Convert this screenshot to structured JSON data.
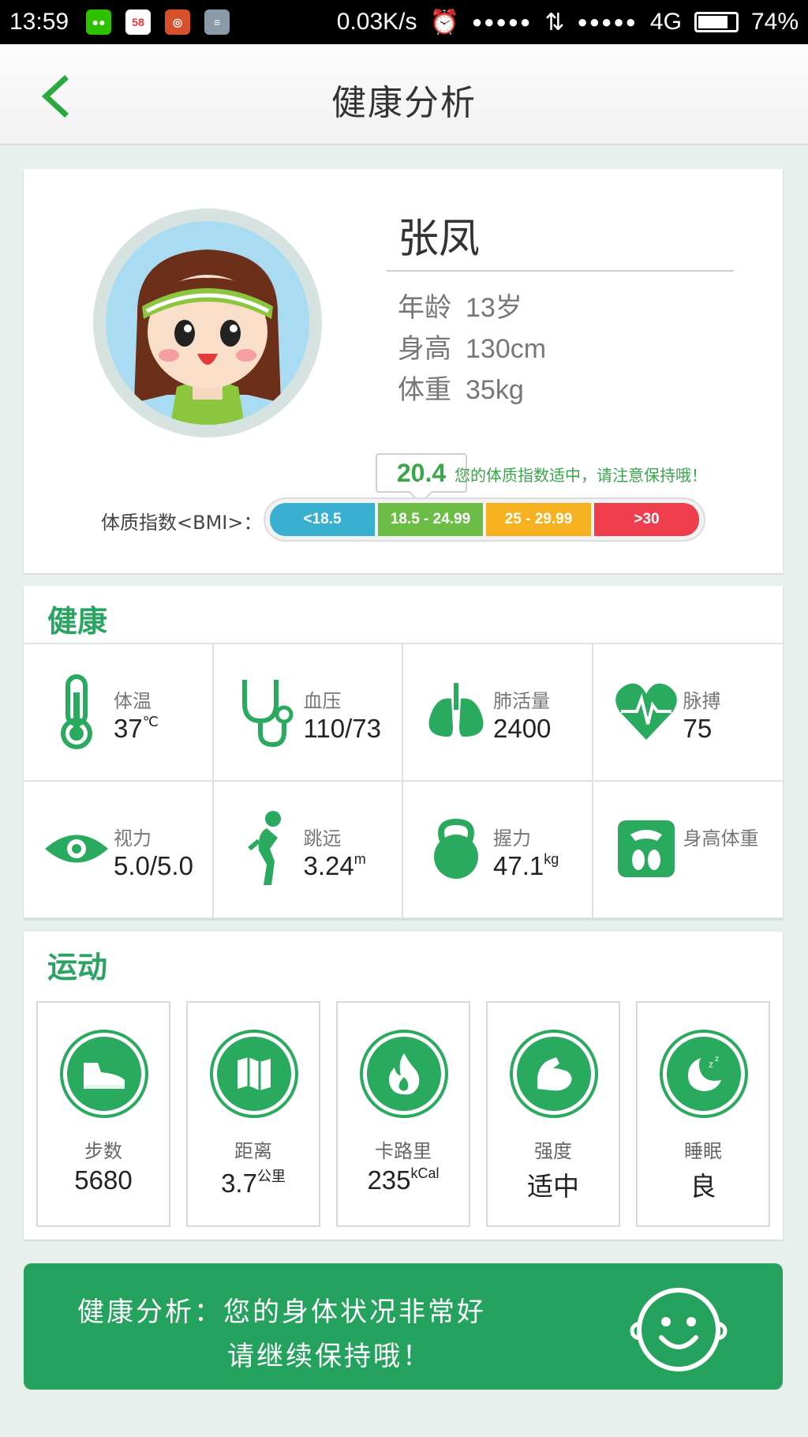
{
  "status_bar": {
    "time": "13:59",
    "network_speed": "0.03K/s",
    "signal_dots_1": "●●●●●",
    "signal_dots_2": "●●●●●",
    "network_type": "4G",
    "battery": "74%",
    "app_58": "58"
  },
  "header": {
    "title": "健康分析"
  },
  "profile": {
    "name": "张凤",
    "age_label": "年龄",
    "age_value": "13岁",
    "height_label": "身高",
    "height_value": "130cm",
    "weight_label": "体重",
    "weight_value": "35kg",
    "bmi_value": "20.4",
    "bmi_message": "您的体质指数适中，请注意保持哦！",
    "bmi_label": "体质指数<BMI>：",
    "bmi_ranges": [
      {
        "label": "<18.5",
        "color": "#3ab0d0"
      },
      {
        "label": "18.5 - 24.99",
        "color": "#6cbd45"
      },
      {
        "label": "25 - 29.99",
        "color": "#f5b120"
      },
      {
        "label": ">30",
        "color": "#ee3e4d"
      }
    ]
  },
  "health": {
    "title": "健康",
    "items": [
      {
        "icon": "thermometer-icon",
        "label": "体温",
        "value": "37",
        "unit": "℃"
      },
      {
        "icon": "stethoscope-icon",
        "label": "血压",
        "value": "110/73",
        "unit": ""
      },
      {
        "icon": "lungs-icon",
        "label": "肺活量",
        "value": "2400",
        "unit": ""
      },
      {
        "icon": "heart-pulse-icon",
        "label": "脉搏",
        "value": "75",
        "unit": ""
      },
      {
        "icon": "eye-icon",
        "label": "视力",
        "value": "5.0/5.0",
        "unit": ""
      },
      {
        "icon": "long-jump-icon",
        "label": "跳远",
        "value": "3.24",
        "unit": "m"
      },
      {
        "icon": "kettlebell-icon",
        "label": "握力",
        "value": "47.1",
        "unit": "kg"
      },
      {
        "icon": "scale-icon",
        "label": "身高体重",
        "value": "",
        "unit": ""
      }
    ]
  },
  "sport": {
    "title": "运动",
    "items": [
      {
        "icon": "shoe-icon",
        "label": "步数",
        "value": "5680",
        "unit": ""
      },
      {
        "icon": "map-icon",
        "label": "距离",
        "value": "3.7",
        "unit": "公里"
      },
      {
        "icon": "flame-icon",
        "label": "卡路里",
        "value": "235",
        "unit": "kCal"
      },
      {
        "icon": "muscle-icon",
        "label": "强度",
        "value": "适中",
        "unit": ""
      },
      {
        "icon": "moon-sleep-icon",
        "label": "睡眠",
        "value": "良",
        "unit": ""
      }
    ]
  },
  "analysis": {
    "line1": "健康分析：您的身体状况非常好",
    "line2": "请继续保持哦！"
  },
  "colors": {
    "brand_green": "#25a25e",
    "accent_green": "#2aaa5e",
    "bmi_green": "#3aa54a"
  }
}
